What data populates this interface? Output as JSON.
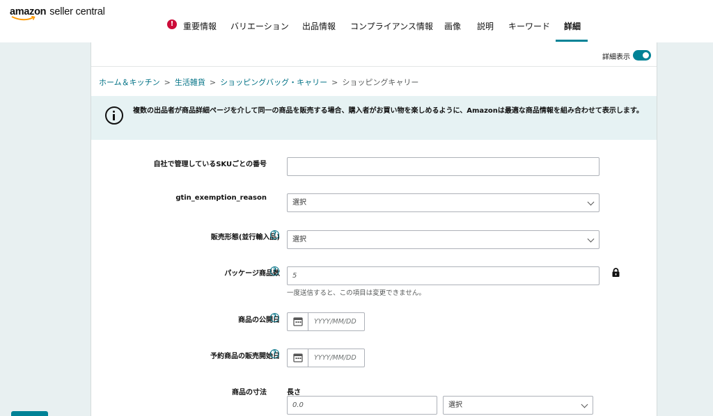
{
  "brand": {
    "logo_word": "amazon",
    "logo_suffix": "seller central"
  },
  "tabs": [
    {
      "label": "重要情報",
      "alert": "!"
    },
    {
      "label": "バリエーション"
    },
    {
      "label": "出品情報"
    },
    {
      "label": "コンプライアンス情報"
    },
    {
      "label": "画像"
    },
    {
      "label": "説明"
    },
    {
      "label": "キーワード"
    },
    {
      "label": "詳細",
      "active": true
    }
  ],
  "detail_toggle": {
    "label": "詳細表示",
    "on": true
  },
  "breadcrumb": {
    "items": [
      "ホーム＆キッチン",
      "生活雑貨",
      "ショッピングバッグ・キャリー"
    ],
    "current": "ショッピングキャリー",
    "separator": ">"
  },
  "info_banner": {
    "text": "複数の出品者が商品詳細ページを介して同一の商品を販売する場合、購入者がお買い物を楽しめるように、Amazonは最適な商品情報を組み合わせて表示します。"
  },
  "form": {
    "sku": {
      "label": "自社で管理しているSKUごとの番号",
      "value": ""
    },
    "gtin": {
      "label": "gtin_exemption_reason",
      "value": "選択"
    },
    "sales_form": {
      "label": "販売形態(並行輸入品)",
      "value": "選択",
      "help": "?"
    },
    "package_qty": {
      "label": "パッケージ商品数",
      "placeholder": "5",
      "help": "?",
      "note": "一度送信すると、この項目は変更できません。"
    },
    "release_date": {
      "label": "商品の公開日",
      "placeholder": "YYYY/MM/DD",
      "help": "?"
    },
    "preorder_date": {
      "label": "予約商品の販売開始日",
      "placeholder": "YYYY/MM/DD",
      "help": "?"
    },
    "dimensions": {
      "label": "商品の寸法",
      "sublabel": "長さ",
      "placeholder": "0.0",
      "unit_value": "選択"
    }
  },
  "colors": {
    "accent": "#008296",
    "link": "#007185",
    "alert": "#cc0c39",
    "info_bg": "#e6f2f3"
  }
}
